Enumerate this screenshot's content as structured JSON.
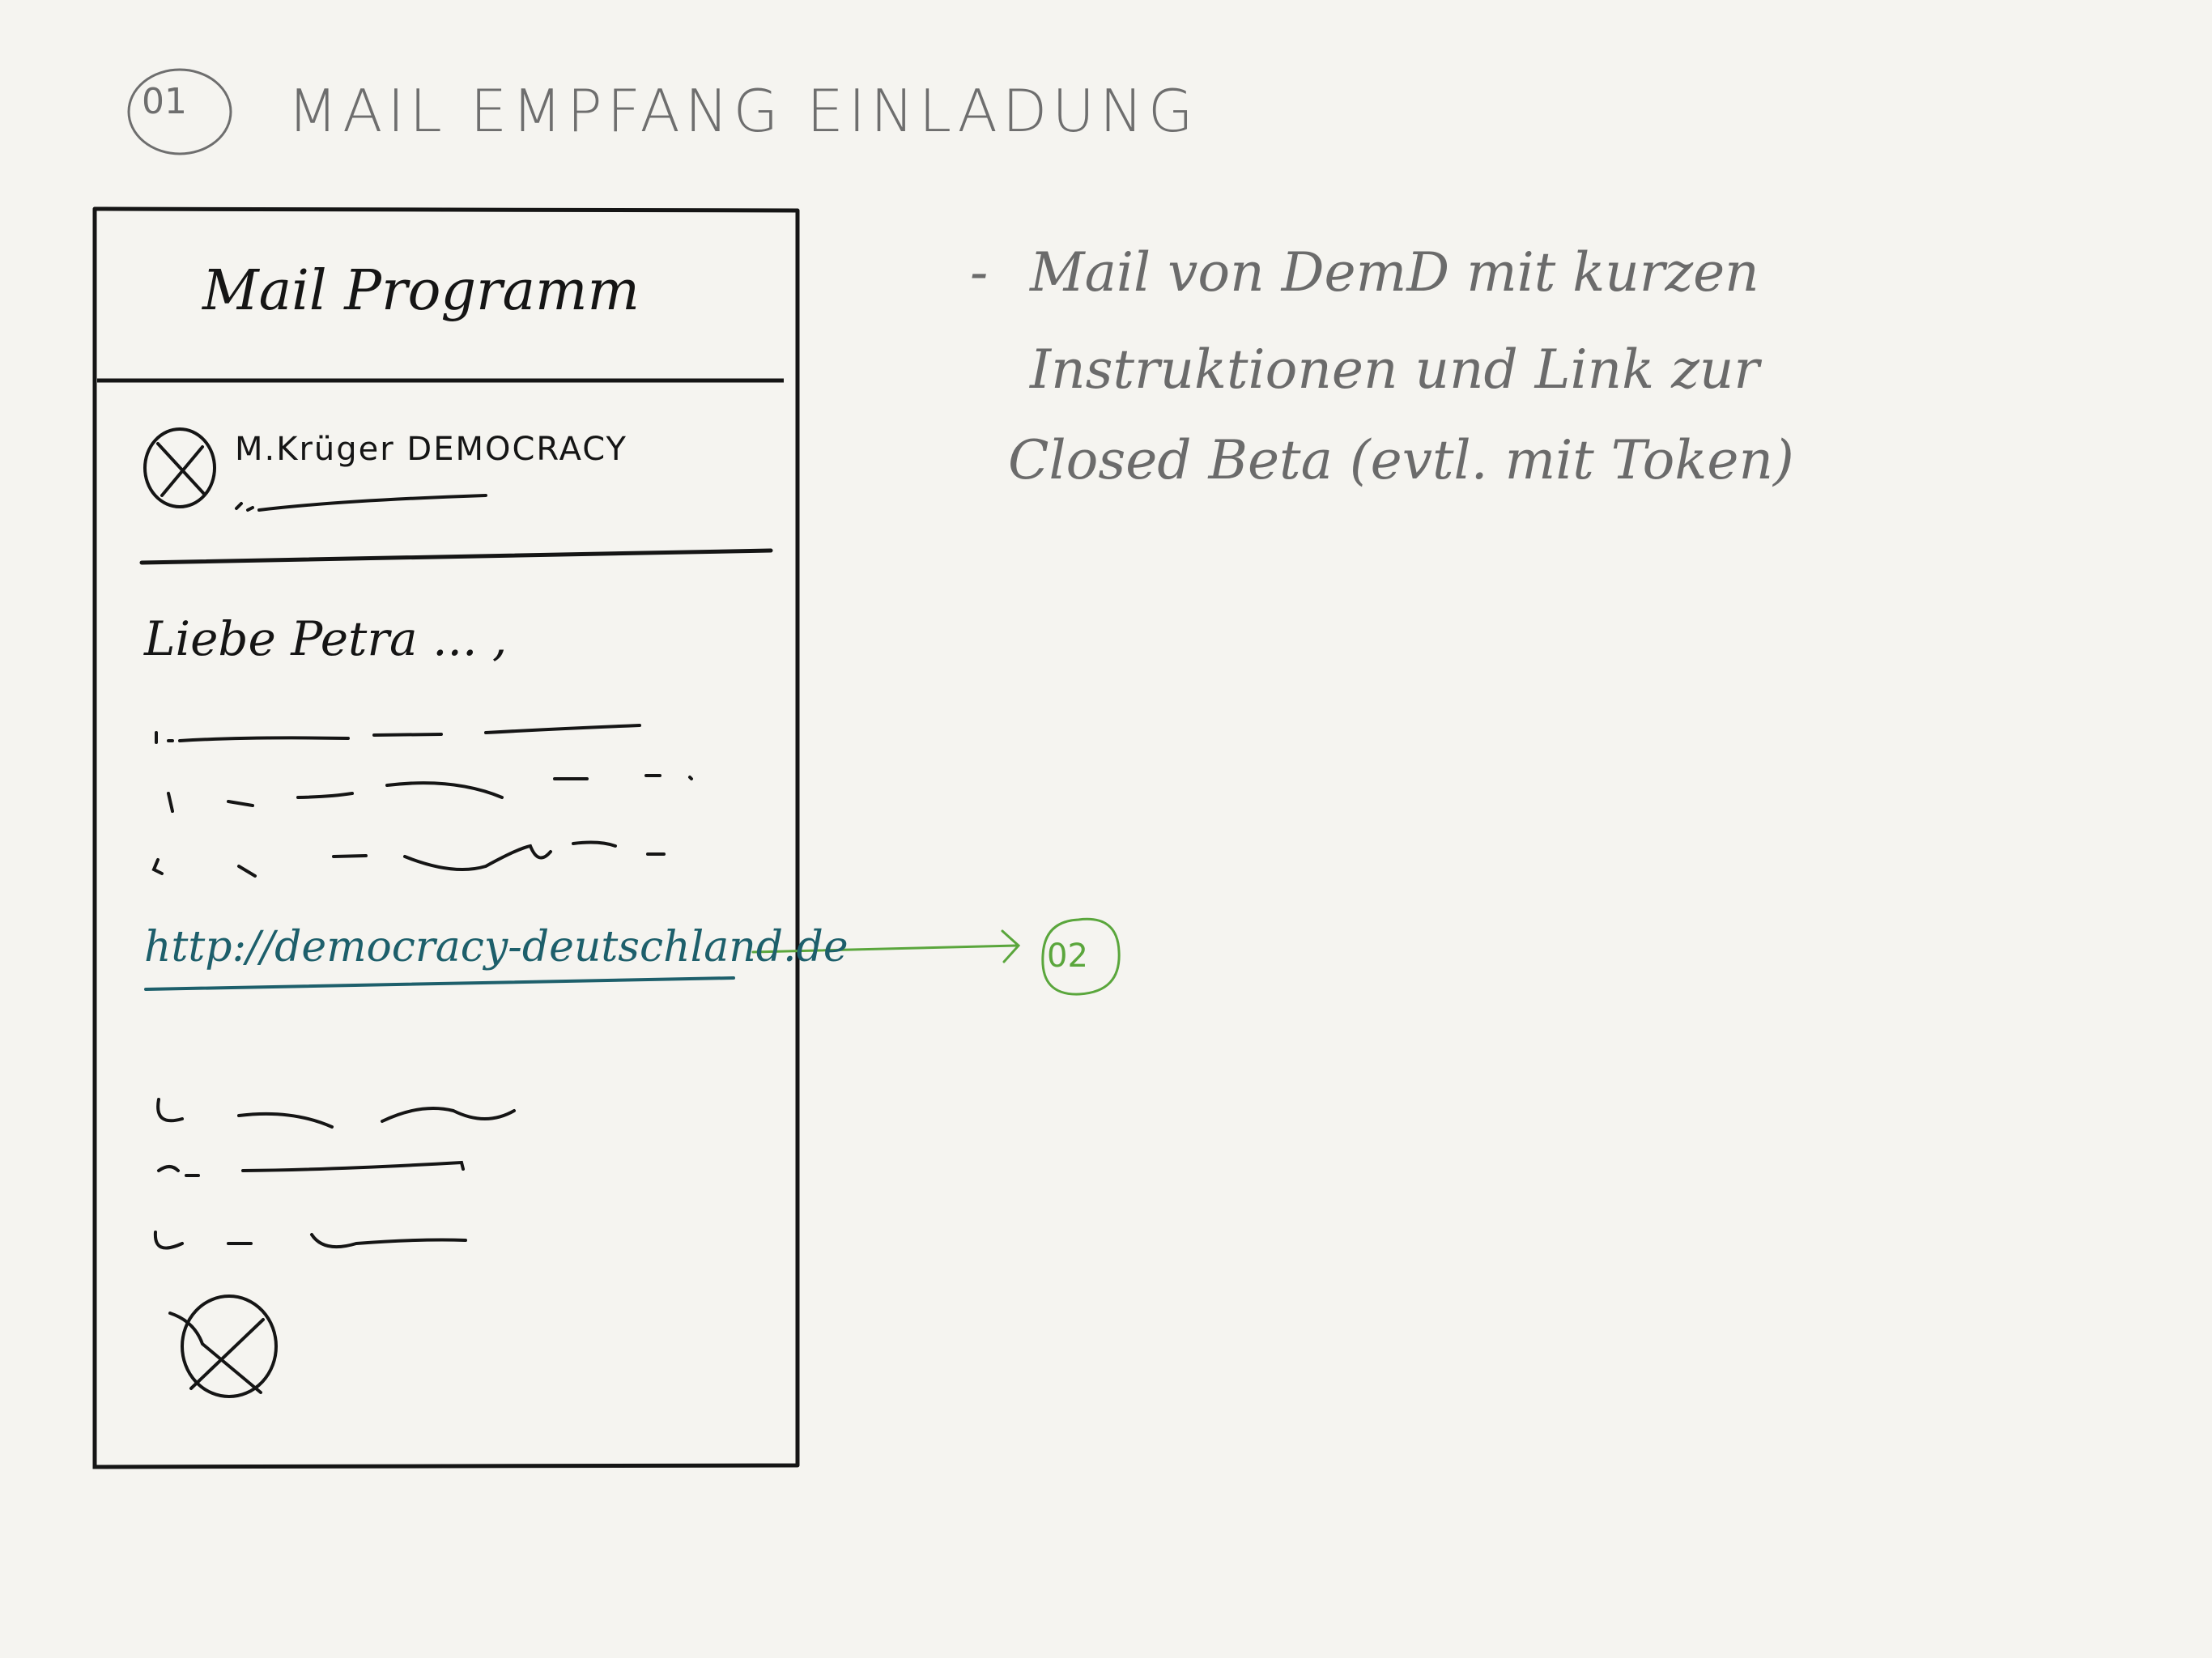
{
  "header": {
    "step_number": "01",
    "title": "MAIL EMPFANG EINLADUNG"
  },
  "mail_window": {
    "app_title": "Mail Programm",
    "sender": "M.Krüger DEMOCRACY",
    "greeting": "Liebe Petra ... ,",
    "link": "http://democracy-deutschland.de"
  },
  "notes": {
    "dash": "-",
    "line1": "Mail von DemD mit kurzen",
    "line2": "Instruktionen und Link zur",
    "line3": "Closed Beta  (evtl. mit Token)"
  },
  "next_step": {
    "number": "02"
  },
  "colors": {
    "ink": "#151515",
    "pencil": "#6e6e6e",
    "link": "#1d5f6b",
    "arrow": "#5aa63c",
    "paper": "#f5f4f0"
  }
}
